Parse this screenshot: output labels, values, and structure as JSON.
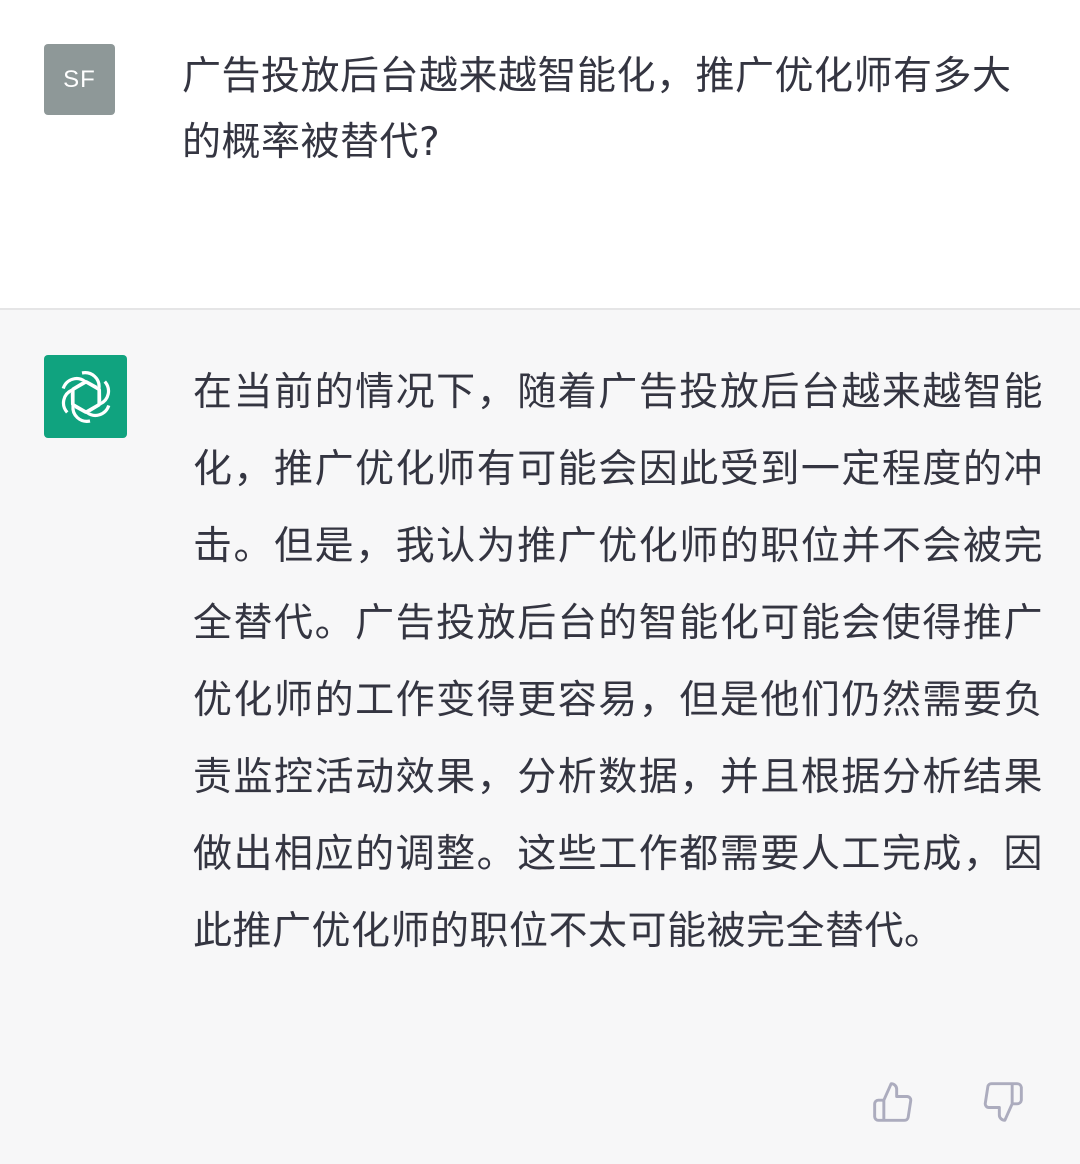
{
  "user": {
    "avatar_initials": "SF",
    "message": "广告投放后台越来越智能化，推广优化师有多大的概率被替代?"
  },
  "assistant": {
    "avatar_icon": "openai-logo-icon",
    "message": "在当前的情况下，随着广告投放后台越来越智能化，推广优化师有可能会因此受到一定程度的冲击。但是，我认为推广优化师的职位并不会被完全替代。广告投放后台的智能化可能会使得推广优化师的工作变得更容易，但是他们仍然需要负责监控活动效果，分析数据，并且根据分析结果做出相应的调整。这些工作都需要人工完成，因此推广优化师的职位不太可能被完全替代。"
  },
  "feedback": {
    "like_icon": "thumbs-up-icon",
    "dislike_icon": "thumbs-down-icon"
  },
  "colors": {
    "user_bg": "#ffffff",
    "assistant_bg": "#f7f7f8",
    "user_avatar": "#8e9898",
    "bot_avatar": "#10a37f",
    "text": "#343541",
    "icon": "#acacbe"
  }
}
